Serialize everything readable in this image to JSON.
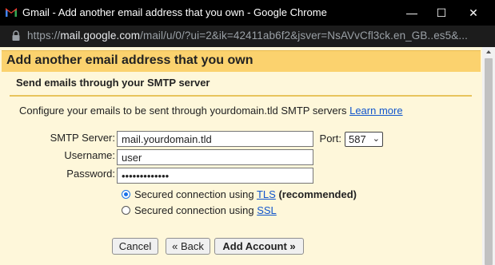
{
  "window": {
    "title": "Gmail - Add another email address that you own - Google Chrome",
    "icon": "gmail-logo",
    "controls": {
      "minimize": "—",
      "maximize": "☐",
      "close": "✕"
    }
  },
  "addressbar": {
    "scheme": "https://",
    "host": "mail.google.com",
    "path": "/mail/u/0/?ui=2&ik=42411ab6f2&jsver=NsAVvCfl3ck.en_GB..es5&..."
  },
  "dialog": {
    "title": "Add another email address that you own",
    "section_title": "Send emails through your SMTP server",
    "description": "Configure your emails to be sent through yourdomain.tld SMTP servers",
    "learn_more": "Learn more",
    "fields": {
      "smtp_label": "SMTP Server:",
      "smtp_value": "mail.yourdomain.tld",
      "port_label": "Port:",
      "port_value": "587",
      "username_label": "Username:",
      "username_value": "user",
      "password_label": "Password:",
      "password_value": "•••••••••••••"
    },
    "options": {
      "tls_prefix": "Secured connection using ",
      "tls_link": "TLS",
      "tls_suffix": " (recommended)",
      "tls_selected": true,
      "ssl_prefix": "Secured connection using ",
      "ssl_link": "SSL",
      "ssl_selected": false
    },
    "buttons": {
      "cancel": "Cancel",
      "back": "« Back",
      "add": "Add Account »"
    }
  },
  "colors": {
    "header_bg": "#fbd26e",
    "page_bg": "#fef7da",
    "link": "#1155cc",
    "radio_accent": "#1a73e8"
  }
}
